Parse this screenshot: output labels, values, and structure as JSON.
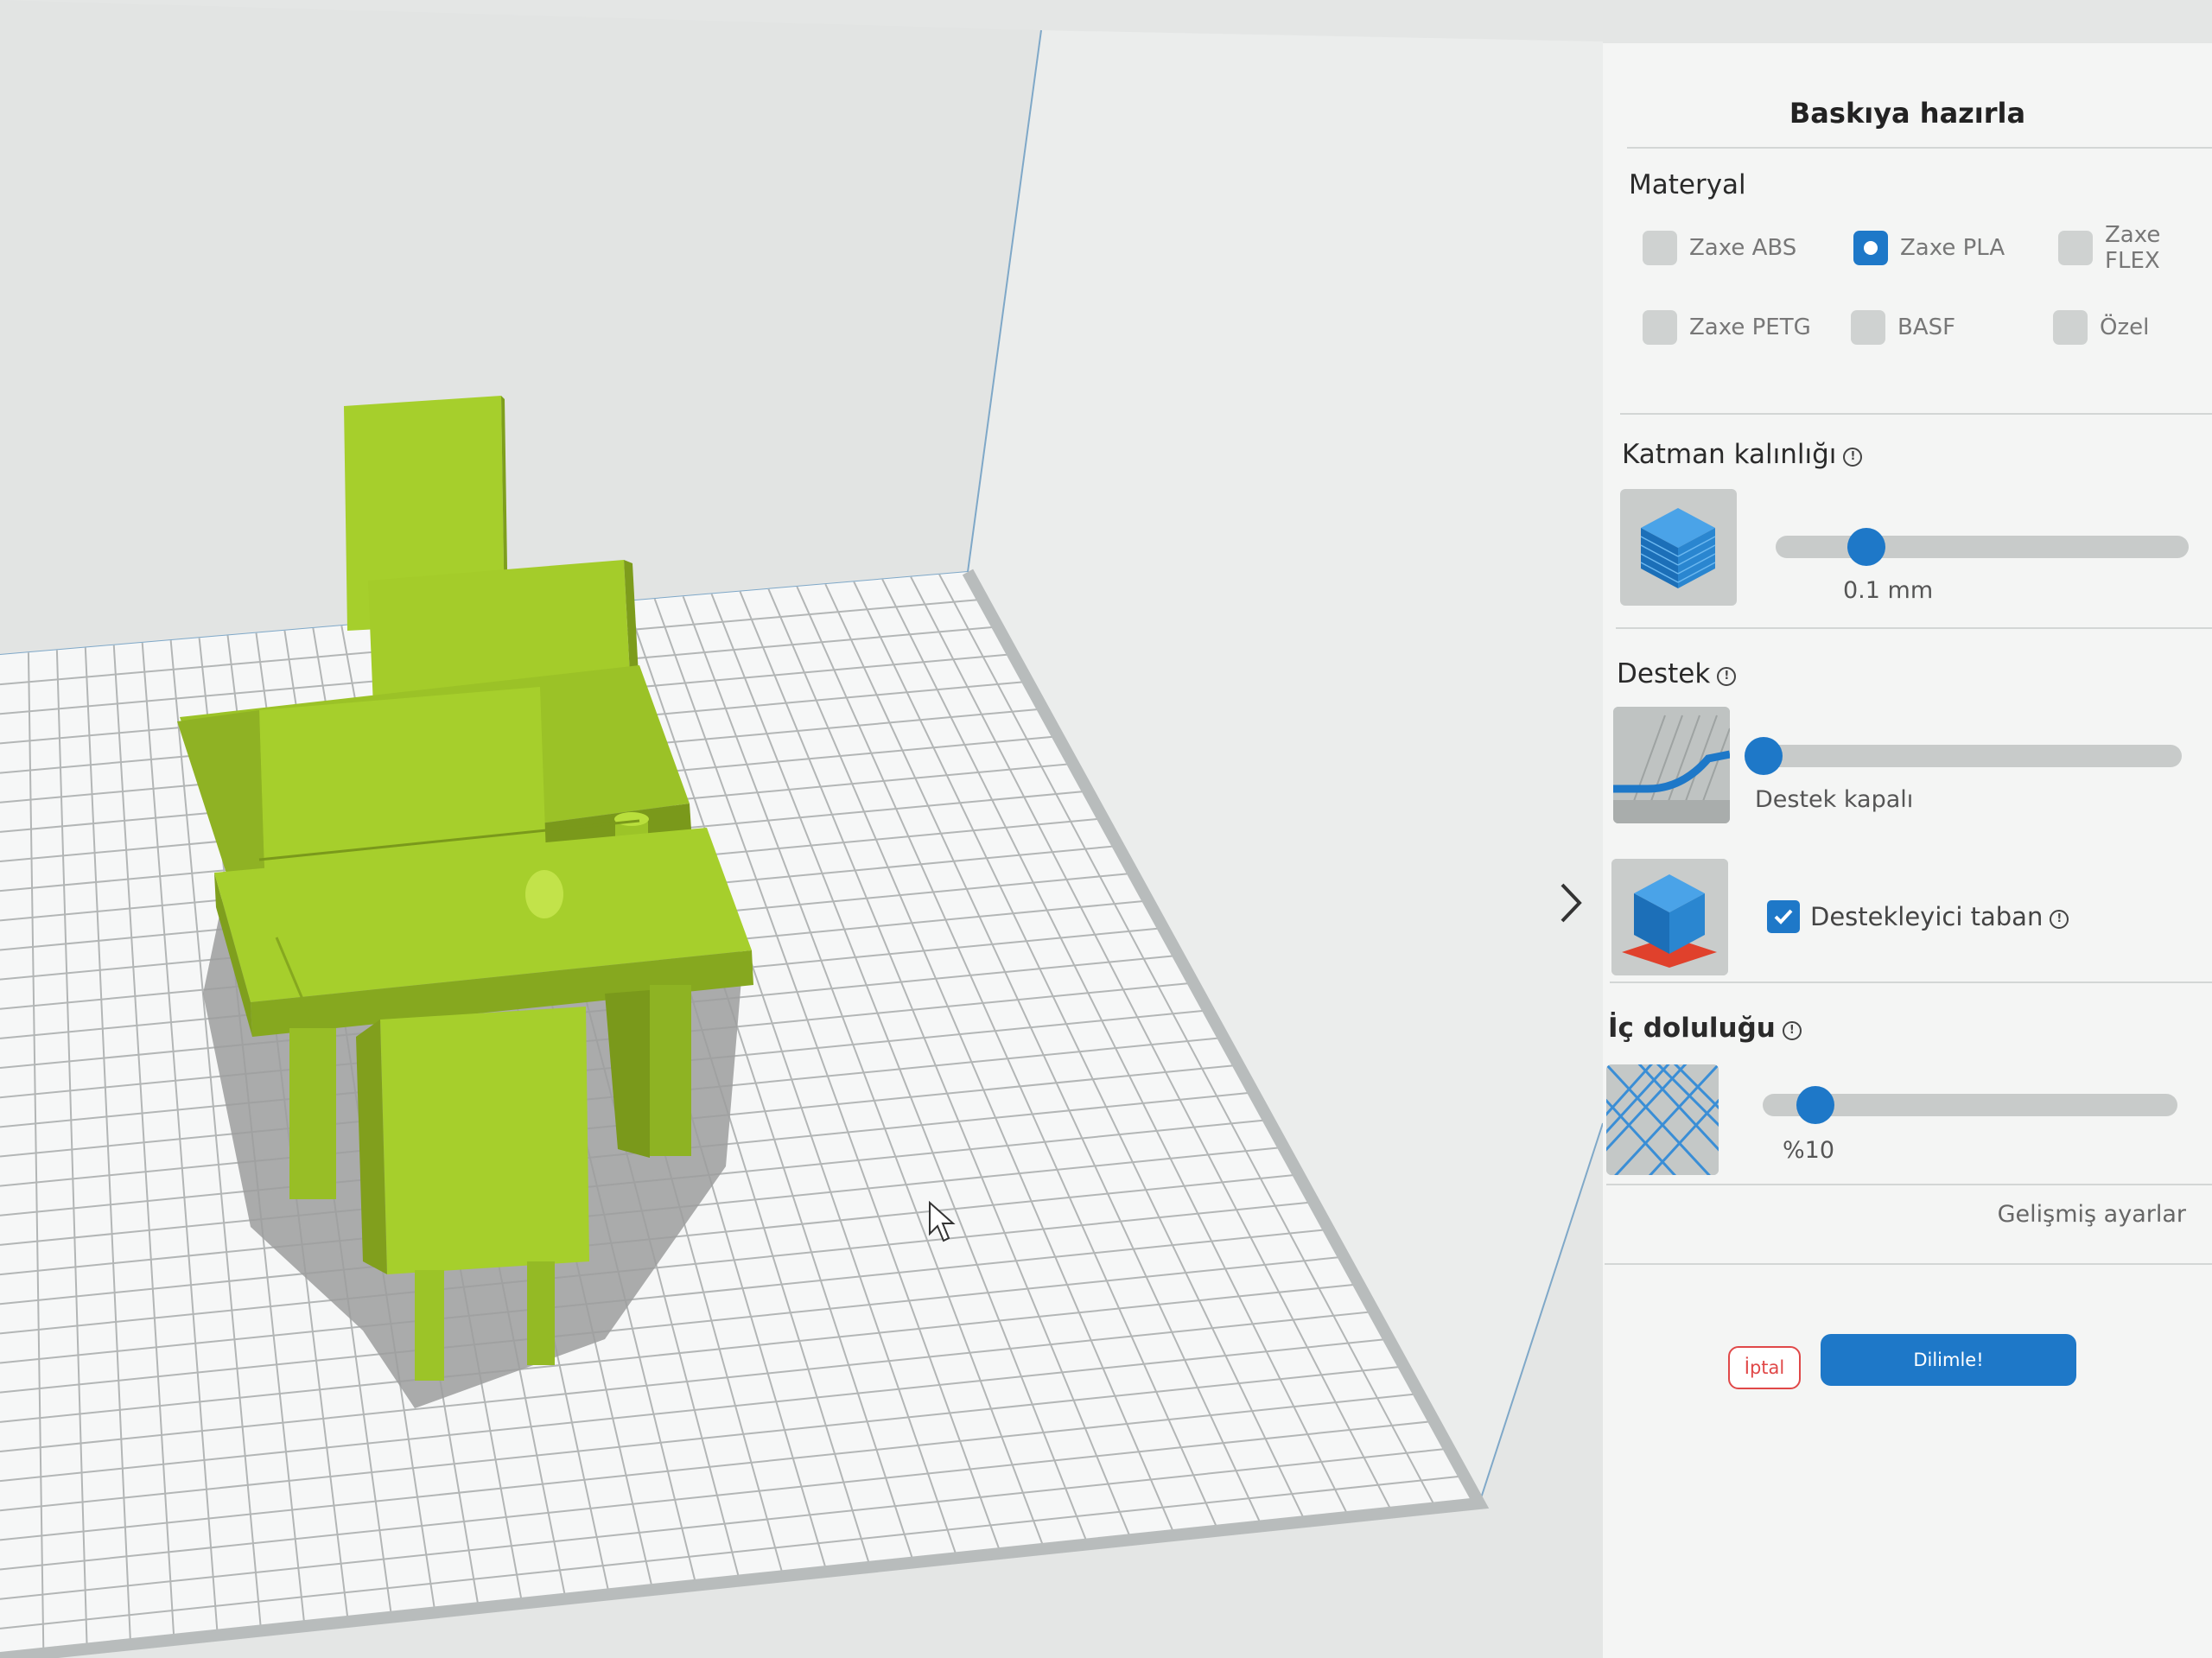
{
  "panel": {
    "title": "Baskıya hazırla",
    "material": {
      "label": "Materyal",
      "options": [
        {
          "label": "Zaxe ABS",
          "selected": false
        },
        {
          "label": "Zaxe PLA",
          "selected": true
        },
        {
          "label": "Zaxe FLEX",
          "selected": false
        },
        {
          "label": "Zaxe PETG",
          "selected": false
        },
        {
          "label": "BASF",
          "selected": false
        },
        {
          "label": "Özel",
          "selected": false
        }
      ]
    },
    "layer": {
      "label": "Katman kalınlığı",
      "value": "0.1 mm",
      "level": 0.2
    },
    "support": {
      "label": "Destek",
      "value": "Destek kapalı",
      "level": 0.0,
      "raft_label": "Destekleyici taban",
      "raft_checked": true
    },
    "infill": {
      "label": "İç doluluğu",
      "value": "%10",
      "level": 0.1
    },
    "advanced_label": "Gelişmiş ayarlar",
    "cancel_label": "İptal",
    "slice_label": "Dilimle!"
  },
  "colors": {
    "accent": "#1e78c8",
    "cancel": "#e04848",
    "model": "#a6cf2c",
    "panel_bg": "#f4f5f4",
    "viewport_bg": "#e4e6e5"
  },
  "icons": {
    "layer_thumb": "blue-cube-icon",
    "support_thumb": "support-curve-icon",
    "raft_thumb": "raft-cube-icon",
    "infill_thumb": "infill-grid-icon",
    "collapse": "chevron-right-icon",
    "pointer": "mouse-cursor-icon"
  }
}
